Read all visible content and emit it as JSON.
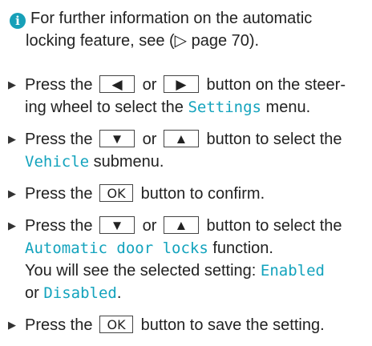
{
  "note": {
    "icon": "info-icon",
    "line1": "For further information on the automatic",
    "line2": "locking feature, see (",
    "arrow": "▷",
    "line2b": " page 70)."
  },
  "steps": [
    {
      "t1": "Press the",
      "key1": "◀",
      "or": "or",
      "key2": "▶",
      "t2": "button on the steer-",
      "t3": "ing wheel to select the",
      "menu": "Settings",
      "t4": "menu."
    },
    {
      "t1": "Press the",
      "key1": "▼",
      "or": "or",
      "key2": "▲",
      "t2": "button to select the",
      "menu": "Vehicle",
      "t4": "submenu."
    },
    {
      "t1": "Press the",
      "key1": "OK",
      "t2": "button to confirm."
    },
    {
      "t1": "Press the",
      "key1": "▼",
      "or": "or",
      "key2": "▲",
      "t2": "button to select the",
      "menu": "Automatic door locks",
      "t4": "function.",
      "t5": "You will see the selected setting:",
      "opt1": "Enabled",
      "or2": "or",
      "opt2": "Disabled",
      "end": "."
    },
    {
      "t1": "Press the",
      "key1": "OK",
      "t2": "button to save the setting."
    }
  ],
  "bullet": "▶",
  "colors": {
    "accent": "#13a3bd",
    "info_icon": "#17a0b8"
  }
}
